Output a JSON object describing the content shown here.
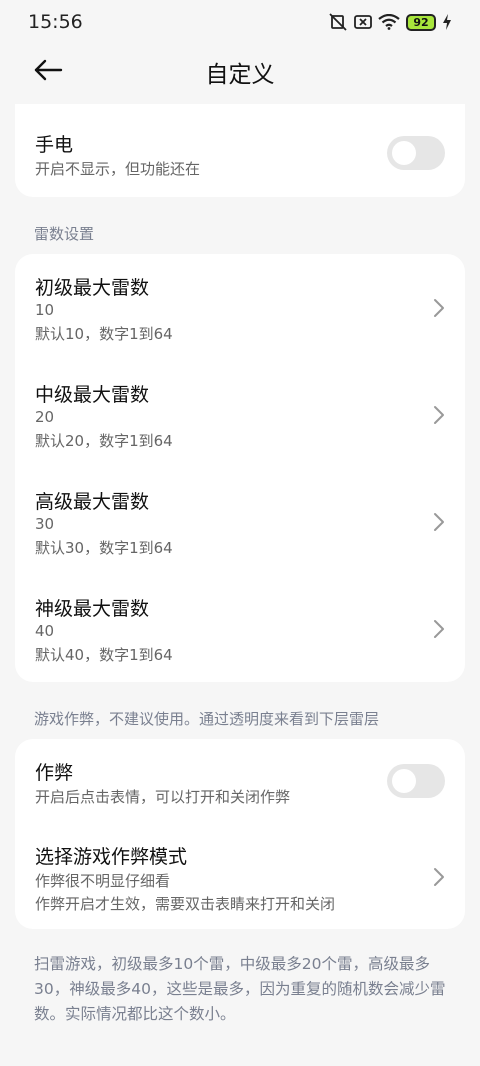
{
  "status": {
    "time": "15:56",
    "battery": "92",
    "icons": [
      "mute-vibrate-icon",
      "sim-error-icon",
      "wifi-icon",
      "battery-icon",
      "charging-icon"
    ]
  },
  "header": {
    "title": "自定义",
    "back_icon": "arrow-left-icon"
  },
  "flashlight": {
    "title": "手电",
    "subtitle": "开启不显示，但功能还在",
    "enabled": false
  },
  "mine_section": {
    "label": "雷数设置",
    "items": [
      {
        "title": "初级最大雷数",
        "value": "10",
        "hint": "默认10，数字1到64"
      },
      {
        "title": "中级最大雷数",
        "value": "20",
        "hint": "默认20，数字1到64"
      },
      {
        "title": "高级最大雷数",
        "value": "30",
        "hint": "默认30，数字1到64"
      },
      {
        "title": "神级最大雷数",
        "value": "40",
        "hint": "默认40，数字1到64"
      }
    ]
  },
  "cheat_section": {
    "label": "游戏作弊，不建议使用。通过透明度来看到下层雷层",
    "cheat_toggle": {
      "title": "作弊",
      "subtitle": "开启后点击表情，可以打开和关闭作弊",
      "enabled": false
    },
    "cheat_mode": {
      "title": "选择游戏作弊模式",
      "value": "作弊很不明显仔细看",
      "hint": "作弊开启才生效，需要双击表睛来打开和关闭"
    }
  },
  "footer_note": "扫雷游戏，初级最多10个雷，中级最多20个雷，高级最多30，神级最多40，这些是最多，因为重复的随机数会减少雷数。实际情况都比这个数小。",
  "colors": {
    "background": "#f6f6f6",
    "card": "#ffffff",
    "toggle_off": "#e6e6e6",
    "battery_fill": "#a8e63c",
    "section_label": "#7a8090"
  }
}
